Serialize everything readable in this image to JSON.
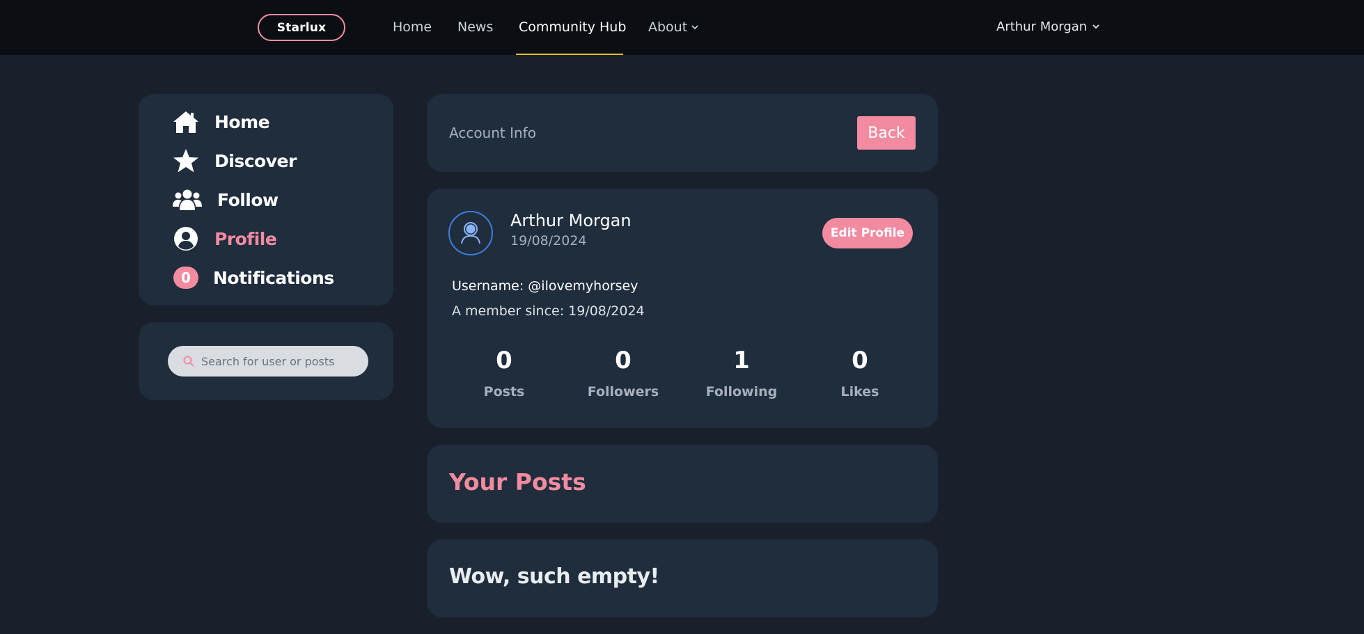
{
  "navbar": {
    "brand": "Starlux",
    "links": [
      {
        "label": "Home"
      },
      {
        "label": "News"
      },
      {
        "label": "Community Hub",
        "active": true
      },
      {
        "label": "About",
        "has_dropdown": true
      }
    ],
    "user_name": "Arthur Morgan",
    "accent_color": "#f4c21c"
  },
  "sidebar": {
    "items": [
      {
        "label": "Home",
        "icon": "home-icon"
      },
      {
        "label": "Discover",
        "icon": "star-icon"
      },
      {
        "label": "Follow",
        "icon": "users-icon"
      },
      {
        "label": "Profile",
        "icon": "user-circle-icon",
        "active": true
      },
      {
        "label": "Notifications",
        "icon": "notification-badge",
        "badge_count": "0"
      }
    ],
    "active_color": "#f28ba0"
  },
  "search": {
    "placeholder": "Search for user or posts",
    "icon": "search-icon"
  },
  "account": {
    "title": "Account Info",
    "back_label": "Back"
  },
  "profile": {
    "name": "Arthur Morgan",
    "date": "19/08/2024",
    "edit_label": "Edit Profile",
    "username_line": "Username: @ilovemyhorsey",
    "member_since_line": "A member since: 19/08/2024",
    "stats": [
      {
        "value": "0",
        "label": "Posts"
      },
      {
        "value": "0",
        "label": "Followers"
      },
      {
        "value": "1",
        "label": "Following"
      },
      {
        "value": "0",
        "label": "Likes"
      }
    ]
  },
  "posts": {
    "title": "Your Posts",
    "empty_text": "Wow, such empty!"
  },
  "colors": {
    "background": "#19202b",
    "card": "#1f2d3d",
    "navbar": "#0b0f13",
    "pink": "#f28ba0"
  }
}
